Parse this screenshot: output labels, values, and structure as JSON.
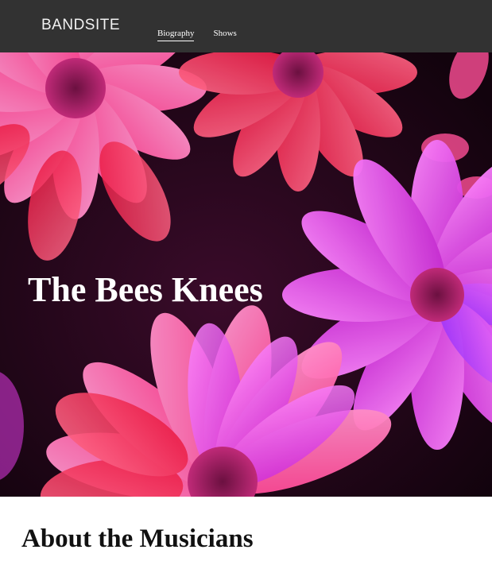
{
  "header": {
    "logo": "BANDSITE",
    "nav": [
      {
        "label": "Biography",
        "active": true
      },
      {
        "label": "Shows",
        "active": false
      }
    ]
  },
  "hero": {
    "title": "The Bees Knees",
    "image": "pink-and-magenta-flowers-photo"
  },
  "about": {
    "heading": "About the Musicians"
  },
  "colors": {
    "header_bg": "#323232",
    "flower_pink": "#ff4fa3",
    "flower_magenta": "#e23be6",
    "flower_red": "#ff2a55"
  }
}
